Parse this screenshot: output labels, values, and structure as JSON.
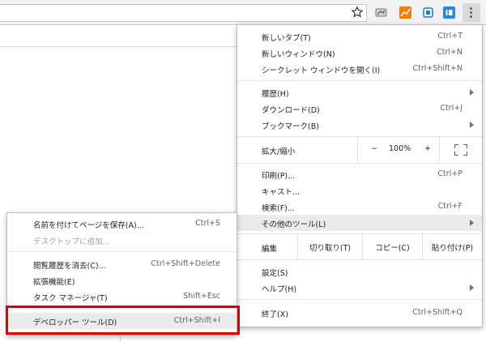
{
  "main_menu": {
    "new_tab": {
      "label": "新しいタブ(T)",
      "shortcut": "Ctrl+T"
    },
    "new_window": {
      "label": "新しいウィンドウ(N)",
      "shortcut": "Ctrl+N"
    },
    "incognito": {
      "label": "シークレット ウィンドウを開く(I)",
      "shortcut": "Ctrl+Shift+N"
    },
    "history": {
      "label": "履歴(H)"
    },
    "downloads": {
      "label": "ダウンロード(D)",
      "shortcut": "Ctrl+J"
    },
    "bookmarks": {
      "label": "ブックマーク(B)"
    },
    "zoom": {
      "label": "拡大/縮小",
      "minus": "−",
      "value": "100%",
      "plus": "+"
    },
    "print": {
      "label": "印刷(P)...",
      "shortcut": "Ctrl+P"
    },
    "cast": {
      "label": "キャスト..."
    },
    "find": {
      "label": "検索(F)...",
      "shortcut": "Ctrl+F"
    },
    "more_tools": {
      "label": "その他のツール(L)"
    },
    "edit": {
      "label": "編集",
      "cut": "切り取り(T)",
      "copy": "コピー(C)",
      "paste": "貼り付け(P)"
    },
    "settings": {
      "label": "設定(S)"
    },
    "help": {
      "label": "ヘルプ(H)"
    },
    "exit": {
      "label": "終了(X)",
      "shortcut": "Ctrl+Shift+Q"
    }
  },
  "sub_menu": {
    "save_page": {
      "label": "名前を付けてページを保存(A)...",
      "shortcut": "Ctrl+S"
    },
    "add_desktop": {
      "label": "デスクトップに追加..."
    },
    "clear_data": {
      "label": "閲覧履歴を消去(C)...",
      "shortcut": "Ctrl+Shift+Delete"
    },
    "extensions": {
      "label": "拡張機能(E)"
    },
    "task_manager": {
      "label": "タスク マネージャ(T)",
      "shortcut": "Shift+Esc"
    },
    "dev_tools": {
      "label": "デベロッパー ツール(D)",
      "shortcut": "Ctrl+Shift+I"
    }
  },
  "colors": {
    "highlight": "#ff0000",
    "hover": "#ebebeb"
  },
  "icons": [
    "star-icon",
    "extension-icon",
    "more-vert-icon",
    "fullscreen-icon",
    "submenu-arrow-icon"
  ]
}
